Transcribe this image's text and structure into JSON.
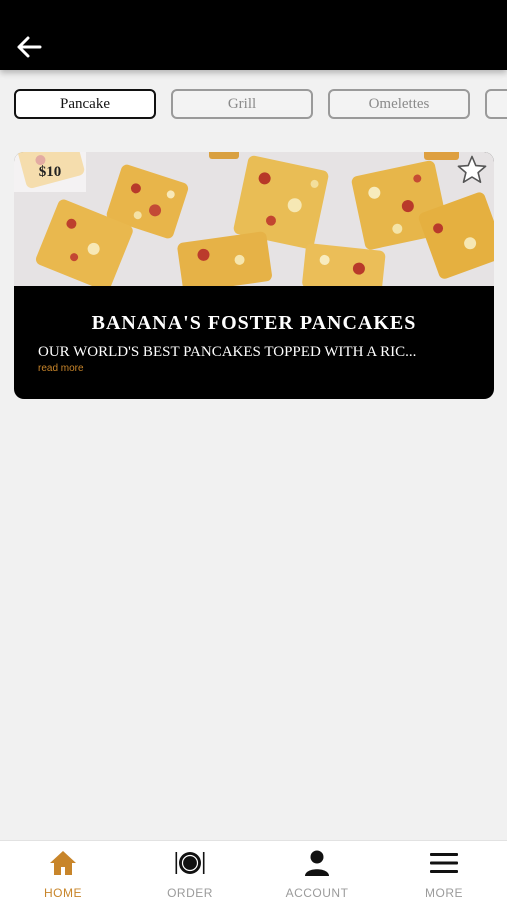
{
  "header": {
    "back_icon": "arrow-left-icon"
  },
  "tabs": [
    {
      "label": "Pancake",
      "active": true
    },
    {
      "label": "Grill",
      "active": false
    },
    {
      "label": "Omelettes",
      "active": false
    },
    {
      "label": "",
      "active": false
    }
  ],
  "menu_item": {
    "price": "$10",
    "title": "BANANA'S FOSTER PANCAKES",
    "description": "OUR WORLD'S BEST PANCAKES TOPPED WITH A RIC...",
    "read_more": "read more",
    "favorite_icon": "star-outline-icon"
  },
  "bottom_nav": [
    {
      "label": "HOME",
      "icon": "home-icon",
      "active": true
    },
    {
      "label": "ORDER",
      "icon": "plate-cutlery-icon",
      "active": false
    },
    {
      "label": "ACCOUNT",
      "icon": "person-icon",
      "active": false
    },
    {
      "label": "MORE",
      "icon": "menu-lines-icon",
      "active": false
    }
  ],
  "colors": {
    "accent": "#c8852a",
    "header_bg": "#000000",
    "page_bg": "#f1f1f1"
  }
}
